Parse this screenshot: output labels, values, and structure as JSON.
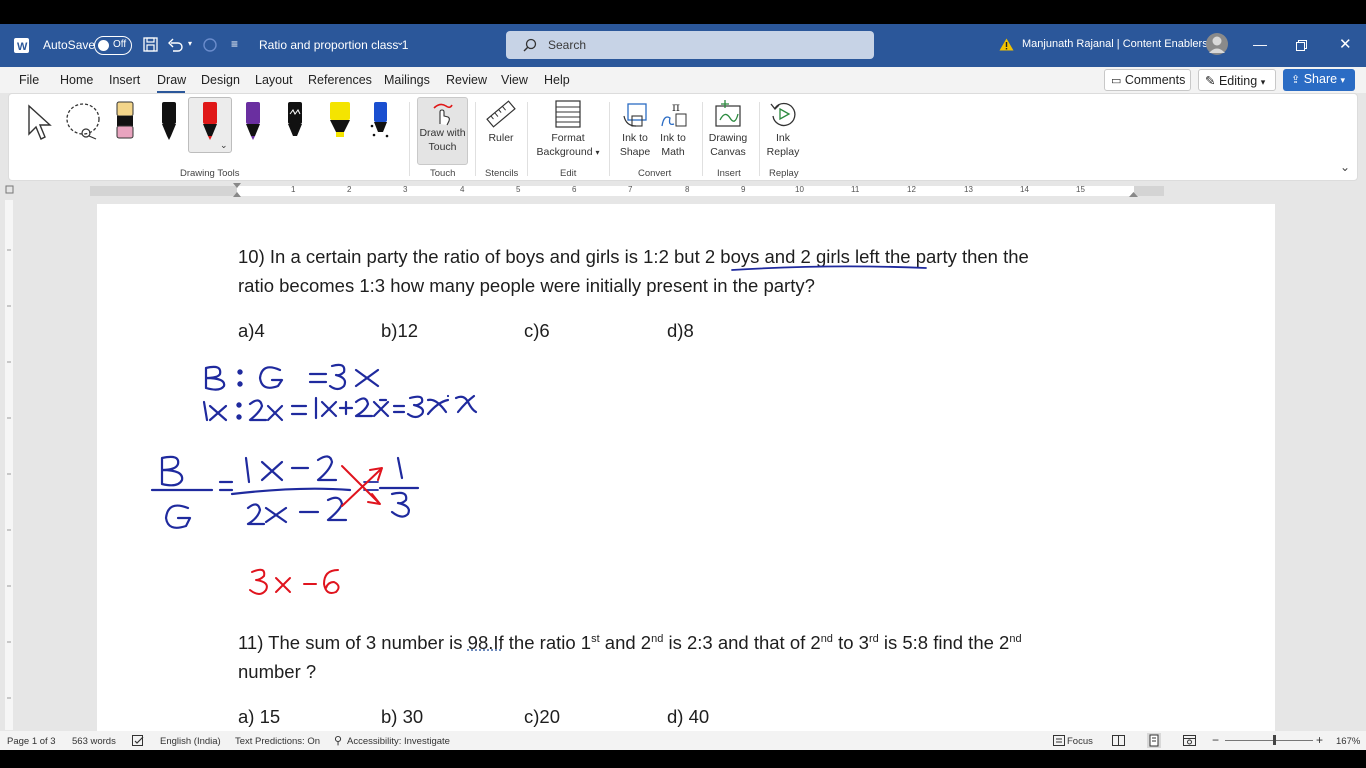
{
  "titlebar": {
    "autosave_label": "AutoSave",
    "autosave_state": "Off",
    "document_title": "Ratio and proportion class 1",
    "search_placeholder": "Search",
    "user_name": "Manjunath Rajanal | Content Enablers"
  },
  "tabs": [
    "File",
    "Home",
    "Insert",
    "Draw",
    "Design",
    "Layout",
    "References",
    "Mailings",
    "Review",
    "View",
    "Help"
  ],
  "active_tab": "Draw",
  "topright": {
    "comments": "Comments",
    "editing": "Editing",
    "share": "Share"
  },
  "ribbon": {
    "draw_with_touch": [
      "Draw with",
      "Touch"
    ],
    "ruler": "Ruler",
    "format_background": [
      "Format",
      "Background"
    ],
    "ink_to_shape": [
      "Ink to",
      "Shape"
    ],
    "ink_to_math": [
      "Ink to",
      "Math"
    ],
    "drawing_canvas": [
      "Drawing",
      "Canvas"
    ],
    "ink_replay": [
      "Ink",
      "Replay"
    ],
    "groups": {
      "drawing_tools": "Drawing Tools",
      "touch": "Touch",
      "stencils": "Stencils",
      "edit": "Edit",
      "convert": "Convert",
      "insert": "Insert",
      "replay": "Replay"
    },
    "pen_colors": [
      "#222222",
      "#e8b4b8",
      "#111111",
      "#e01818",
      "#6a2fa0",
      "#111111",
      "#f4e400",
      "#1a4fd0"
    ]
  },
  "ruler_numbers": [
    "1",
    "2",
    "3",
    "4",
    "5",
    "6",
    "7",
    "8",
    "9",
    "10",
    "11",
    "12",
    "13",
    "14",
    "15"
  ],
  "document": {
    "q10_line1_start": "10) In a certain party the ratio of boys and girls is 1:2 but ",
    "q10_line1_underlined": "2 boys and 2 girls left",
    "q10_line1_end": " the party then the",
    "q10_line2": "ratio becomes 1:3 how many people were initially present in the party?",
    "q10_options": [
      "a)4",
      "b)12",
      "c)6",
      "d)8"
    ],
    "q11_line1_a": "11) The sum of 3 number is ",
    "q11_line1_b": "98.If",
    "q11_line1_c": " the ratio 1",
    "q11_line1_d": " and 2",
    "q11_line1_e": " is 2:3 and that of 2",
    "q11_line1_f": " to 3",
    "q11_line1_g": " is 5:8 find the 2",
    "sup_st": "st",
    "sup_nd": "nd",
    "sup_rd": "rd",
    "q11_line2": "number ?",
    "q11_options": [
      "a) 15",
      "b) 30",
      "c)20",
      "d) 40"
    ]
  },
  "ink_colors": {
    "blue": "#1f2a9e",
    "red": "#e0141e"
  },
  "status": {
    "page": "Page 1 of 3",
    "words": "563 words",
    "language": "English (India)",
    "text_predictions": "Text Predictions: On",
    "accessibility": "Accessibility: Investigate",
    "focus": "Focus",
    "zoom": "167%"
  }
}
